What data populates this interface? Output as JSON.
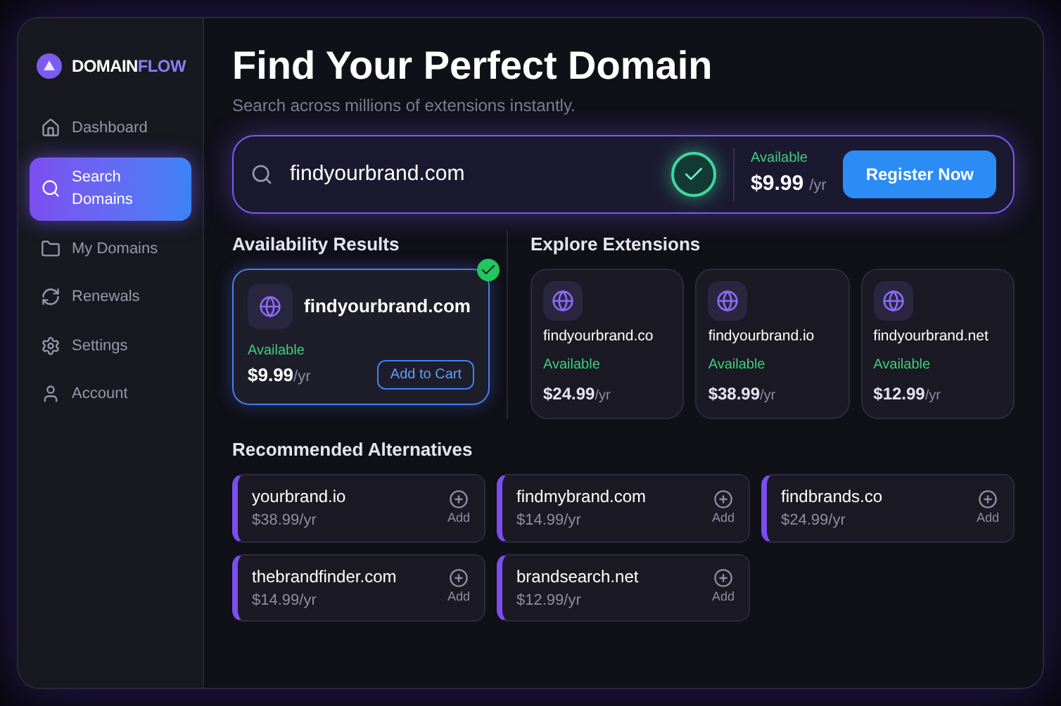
{
  "brand": {
    "primary": "DOMAIN",
    "accent": "FLOW"
  },
  "sidebar": {
    "items": [
      {
        "label": "Dashboard",
        "selected": false
      },
      {
        "label": "Search Domains",
        "selected": true
      },
      {
        "label": "My Domains",
        "selected": false
      },
      {
        "label": "Renewals",
        "selected": false
      },
      {
        "label": "Settings",
        "selected": false
      },
      {
        "label": "Account",
        "selected": false
      }
    ]
  },
  "header": {
    "title": "Find Your Perfect Domain",
    "subtitle": "Search across millions of extensions instantly."
  },
  "search": {
    "value": "findyourbrand.com",
    "available": true,
    "status": "Available",
    "price": "$9.99",
    "unit": "/yr",
    "button": "Register Now"
  },
  "availability": {
    "heading": "Availability Results",
    "result": {
      "domain": "findyourbrand.com",
      "available": true,
      "status": "Available",
      "price": "$9.99",
      "unit": "/yr",
      "button": "Add to Cart"
    }
  },
  "extensions": {
    "heading": "Explore Extensions",
    "items": [
      {
        "domain": "findyourbrand.co",
        "status": "Available",
        "price": "$24.99",
        "unit": "/yr"
      },
      {
        "domain": "findyourbrand.io",
        "status": "Available",
        "price": "$38.99",
        "unit": "/yr"
      },
      {
        "domain": "findyourbrand.net",
        "status": "Available",
        "price": "$12.99",
        "unit": "/yr"
      }
    ]
  },
  "alternatives": {
    "heading": "Recommended Alternatives",
    "items": [
      {
        "domain": "yourbrand.io",
        "price": "$38.99/yr",
        "add": "Add"
      },
      {
        "domain": "findmybrand.com",
        "price": "$14.99/yr",
        "add": "Add"
      },
      {
        "domain": "findbrands.co",
        "price": "$24.99/yr",
        "add": "Add"
      },
      {
        "domain": "thebrandfinder.com",
        "price": "$14.99/yr",
        "add": "Add"
      },
      {
        "domain": "brandsearch.net",
        "price": "$12.99/yr",
        "add": "Add"
      }
    ]
  }
}
